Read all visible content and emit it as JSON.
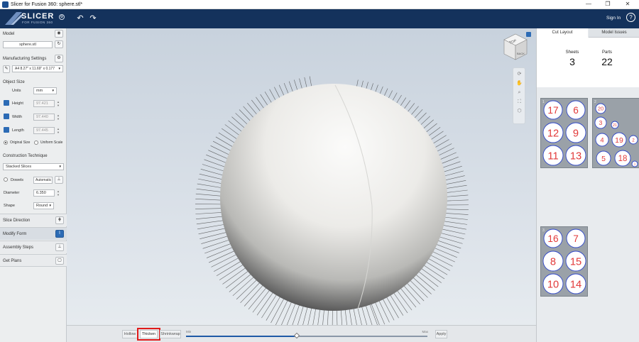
{
  "window": {
    "title": "Slicer for Fusion 360: sphere.stl*",
    "min_label": "—",
    "max_label": "❐",
    "close_label": "✕"
  },
  "brand": {
    "name": "SLICER",
    "sub": "FOR FUSION 360"
  },
  "header": {
    "undo_label": "↶",
    "redo_label": "↷",
    "sign_in": "Sign In",
    "help": "?"
  },
  "left": {
    "model": {
      "header": "Model",
      "file": "sphere.stl"
    },
    "manufacturing": {
      "header": "Manufacturing Settings",
      "sheet": "A4 8.27\" x 11.69\" x 0.177"
    },
    "object_size": {
      "header": "Object Size",
      "units_label": "Units",
      "units_value": "mm",
      "height_label": "Height",
      "height_value": "97.421",
      "width_label": "Width",
      "width_value": "97.440",
      "length_label": "Length",
      "length_value": "97.445",
      "original_size": "Original Size",
      "uniform_scale": "Uniform Scale"
    },
    "construction": {
      "header": "Construction Technique",
      "technique": "Stacked Slices",
      "dowels_label": "Dowels",
      "dowels_value": "Automatic",
      "diameter_label": "Diameter",
      "diameter_value": "6.350",
      "shape_label": "Shape",
      "shape_value": "Round"
    },
    "nav": [
      "Slice Direction",
      "Modify Form",
      "Assembly Steps",
      "Get Plans"
    ]
  },
  "viewport": {
    "cube_top": "TOP",
    "cube_back": "BACK"
  },
  "bottom": {
    "hollow": "Hollow",
    "thicken": "Thicken",
    "shrinkwrap": "Shrinkwrap",
    "min": "Min",
    "max": "Max",
    "apply": "Apply",
    "slider_fraction": 0.46
  },
  "right": {
    "tabs": [
      "Cut Layout",
      "Model Issues"
    ],
    "sheets_label": "Sheets",
    "sheets_value": "3",
    "parts_label": "Parts",
    "parts_value": "22",
    "sheet1": {
      "label": "1",
      "parts": [
        "17",
        "6",
        "12",
        "9",
        "11",
        "13"
      ]
    },
    "sheet2": {
      "label": "2",
      "parts": [
        "20",
        "3",
        "21",
        "4",
        "19",
        "2",
        "5",
        "18",
        "1"
      ]
    },
    "sheet3": {
      "label": "3",
      "parts": [
        "16",
        "7",
        "8",
        "15",
        "10",
        "14"
      ]
    }
  },
  "colors": {
    "appbar": "#14325c",
    "part_outline": "#2f47c9",
    "part_number": "#e23a3a",
    "highlight": "#e01b1b"
  }
}
